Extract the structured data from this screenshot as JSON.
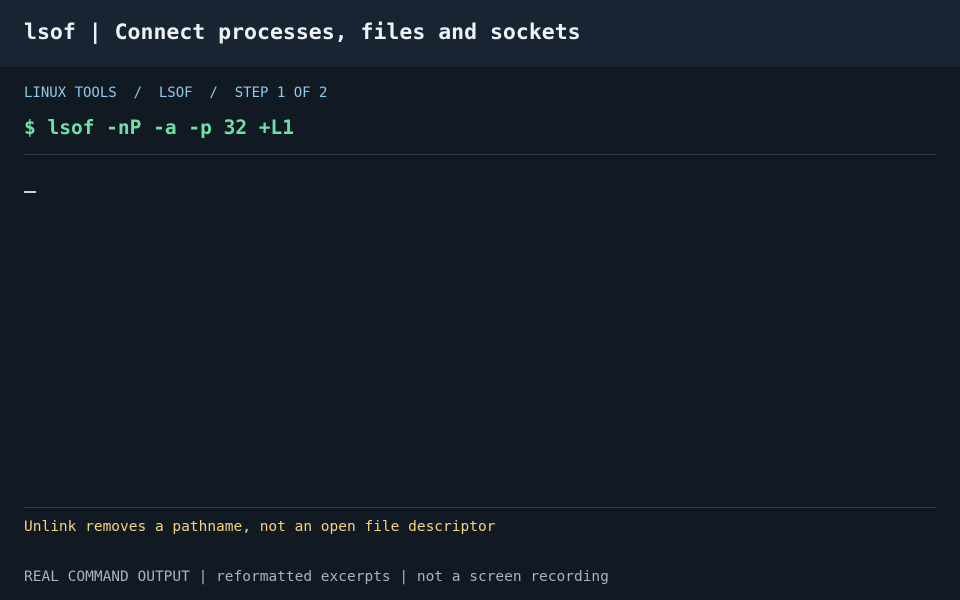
{
  "header": {
    "title": "lsof | Connect processes, files and sockets"
  },
  "breadcrumb": {
    "text": "LINUX TOOLS  /  LSOF  /  STEP 1 OF 2"
  },
  "command": {
    "line": "$ lsof -nP -a -p 32 +L1"
  },
  "terminal": {
    "cursor_glyph": "_"
  },
  "note": {
    "text": "Unlink removes a pathname, not an open file descriptor"
  },
  "footer": {
    "text": "REAL COMMAND OUTPUT | reformatted excerpts | not a screen recording"
  },
  "colors": {
    "background": "#111923",
    "header_background": "#192433",
    "title": "#eef2f7",
    "breadcrumb": "#8ec8ec",
    "command": "#6ee2a6",
    "note": "#f4d27e",
    "footer": "#a7b3bf",
    "rule": "#2b3a47"
  }
}
